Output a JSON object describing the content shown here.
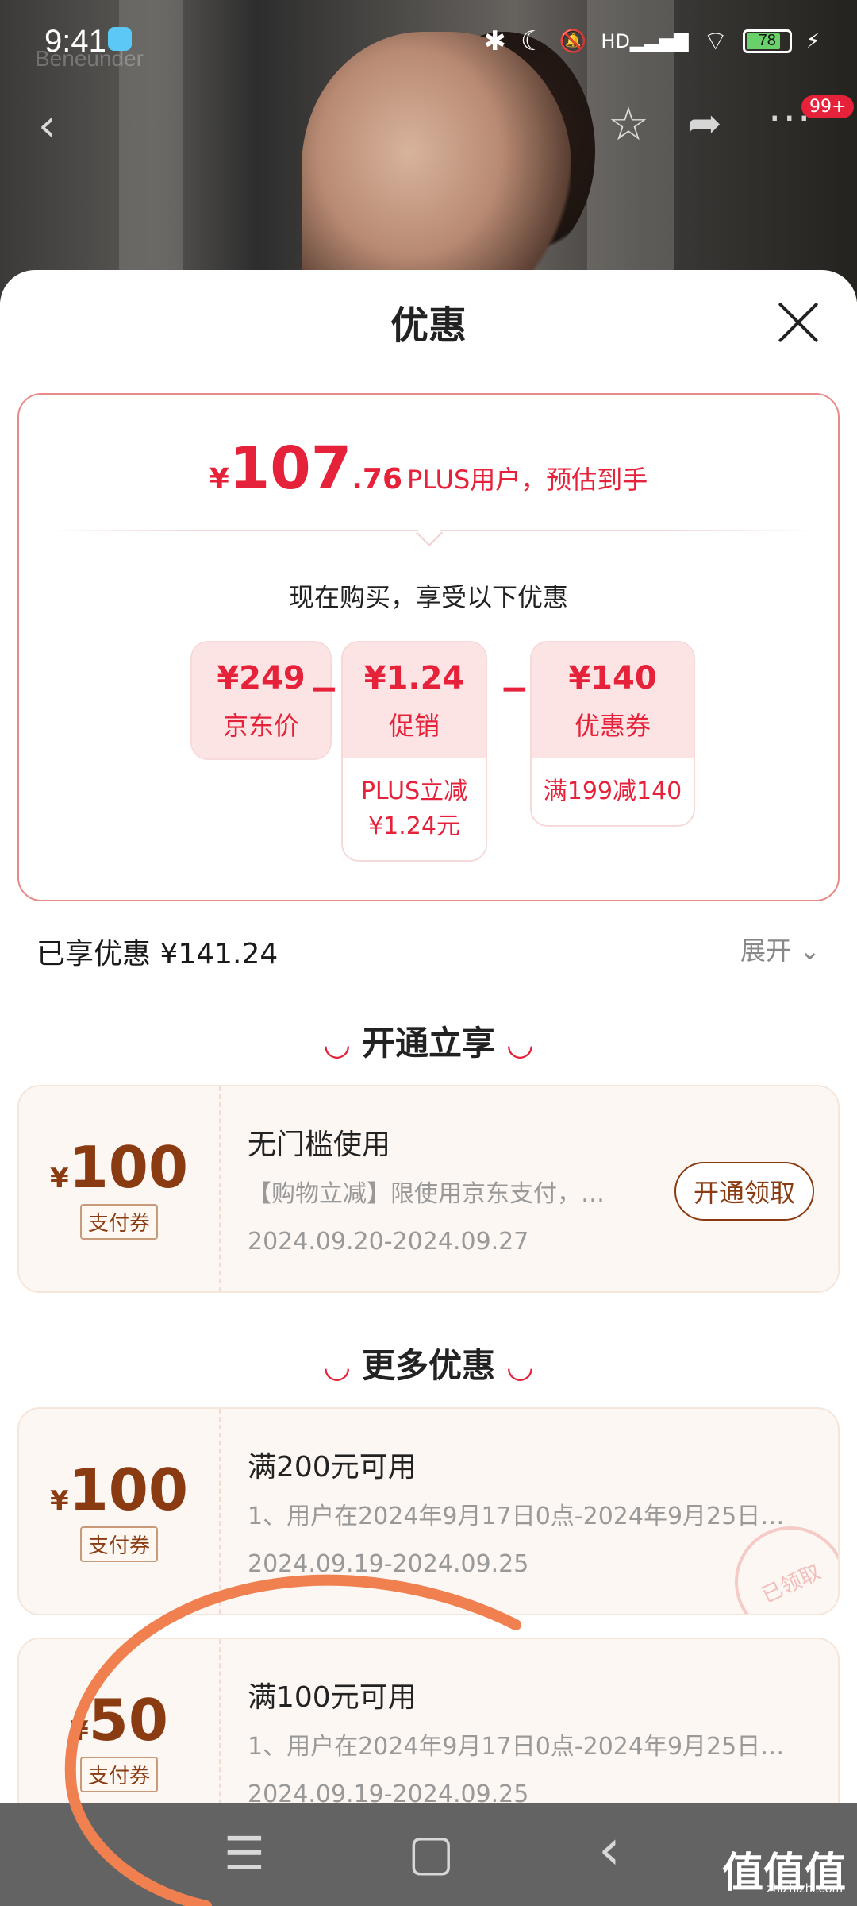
{
  "status_bar": {
    "time": "9:41",
    "battery": "78",
    "icons": [
      "bluetooth-icon",
      "moon-icon",
      "silent-icon",
      "hd-signal-icon",
      "wifi-icon",
      "battery-icon",
      "charging-icon"
    ],
    "glyphs": {
      "bluetooth": "✱",
      "moon": "☾",
      "silent": "🔕",
      "signal": "HD▂▃▅▇",
      "wifi": "⌔",
      "bolt": "⚡"
    }
  },
  "background": {
    "brand_watermark": "Beneunder"
  },
  "top_nav": {
    "back_glyph": "‹",
    "star_glyph": "☆",
    "share_glyph": "➦",
    "more_glyph": "···",
    "message_badge": "99+"
  },
  "sheet": {
    "title": "优惠",
    "close_glyph": ""
  },
  "summary": {
    "currency": "¥",
    "price_int": "107",
    "price_dec": ".76",
    "price_tail": "PLUS用户，预估到手",
    "subtitle": "现在购买，享受以下优惠",
    "minus": "−",
    "items": [
      {
        "amount": "¥249",
        "label": "京东价",
        "detail": ""
      },
      {
        "amount": "¥1.24",
        "label": "促销",
        "detail_line1": "PLUS立减",
        "detail_line2": "¥1.24元"
      },
      {
        "amount": "¥140",
        "label": "优惠券",
        "detail_line1": "满199减140"
      }
    ]
  },
  "enjoyed": {
    "label": "已享优惠 ¥141.24",
    "expand": "展开 ⌄"
  },
  "sections": {
    "open": "开通立享",
    "more": "更多优惠",
    "smile": "◡"
  },
  "coupons": [
    {
      "currency": "¥",
      "amount": "100",
      "tag": "支付券",
      "title": "无门槛使用",
      "desc": "【购物立减】限使用京东支付，…",
      "date": "2024.09.20-2024.09.27",
      "action": "开通领取"
    },
    {
      "currency": "¥",
      "amount": "100",
      "tag": "支付券",
      "title": "满200元可用",
      "desc": "1、用户在2024年9月17日0点-2024年9月25日…",
      "date": "2024.09.19-2024.09.25",
      "stamp": "已领取"
    },
    {
      "currency": "¥",
      "amount": "50",
      "tag": "支付券",
      "title": "满100元可用",
      "desc": "1、用户在2024年9月17日0点-2024年9月25日…",
      "date": "2024.09.19-2024.09.25"
    }
  ],
  "system_nav": {
    "menu": "☰",
    "home": "▢",
    "back": "‹"
  },
  "watermark": {
    "logo": "值值值",
    "site": "zhizhizhi.com"
  },
  "colors": {
    "accent": "#e5223a",
    "coupon_brown": "#8a3b12",
    "annotation_stroke": "#f08050"
  }
}
